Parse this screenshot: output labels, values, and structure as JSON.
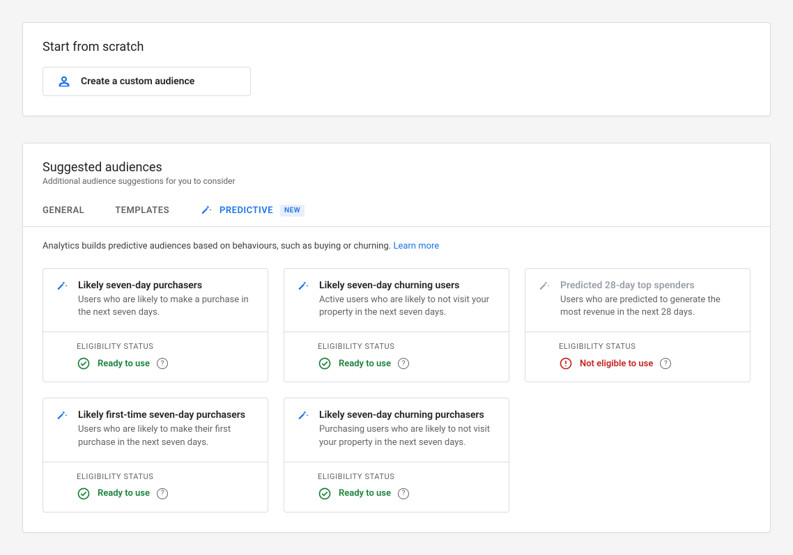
{
  "scratch": {
    "title": "Start from scratch",
    "create_label": "Create a custom audience"
  },
  "suggested": {
    "title": "Suggested audiences",
    "subtitle": "Additional audience suggestions for you to consider",
    "tabs": {
      "general": "GENERAL",
      "templates": "TEMPLATES",
      "predictive": "PREDICTIVE",
      "predictive_badge": "NEW"
    },
    "intro_text": "Analytics builds predictive audiences based on behaviours, such as buying or churning. ",
    "intro_link": "Learn more",
    "elig_label": "ELIGIBILITY STATUS",
    "status_ready": "Ready to use",
    "status_not": "Not eligible to use",
    "cards": [
      {
        "title": "Likely seven-day purchasers",
        "desc": "Users who are likely to make a purchase in the next seven days.",
        "status": "ready"
      },
      {
        "title": "Likely seven-day churning users",
        "desc": "Active users who are likely to not visit your property in the next seven days.",
        "status": "ready"
      },
      {
        "title": "Predicted 28-day top spenders",
        "desc": "Users who are predicted to generate the most revenue in the next 28 days.",
        "status": "not"
      },
      {
        "title": "Likely first-time seven-day purchasers",
        "desc": "Users who are likely to make their first purchase in the next seven days.",
        "status": "ready"
      },
      {
        "title": "Likely seven-day churning purchasers",
        "desc": "Purchasing users who are likely to not visit your property in the next seven days.",
        "status": "ready"
      }
    ]
  },
  "colors": {
    "accent": "#1a73e8",
    "ready": "#188038",
    "not": "#c5221f"
  }
}
